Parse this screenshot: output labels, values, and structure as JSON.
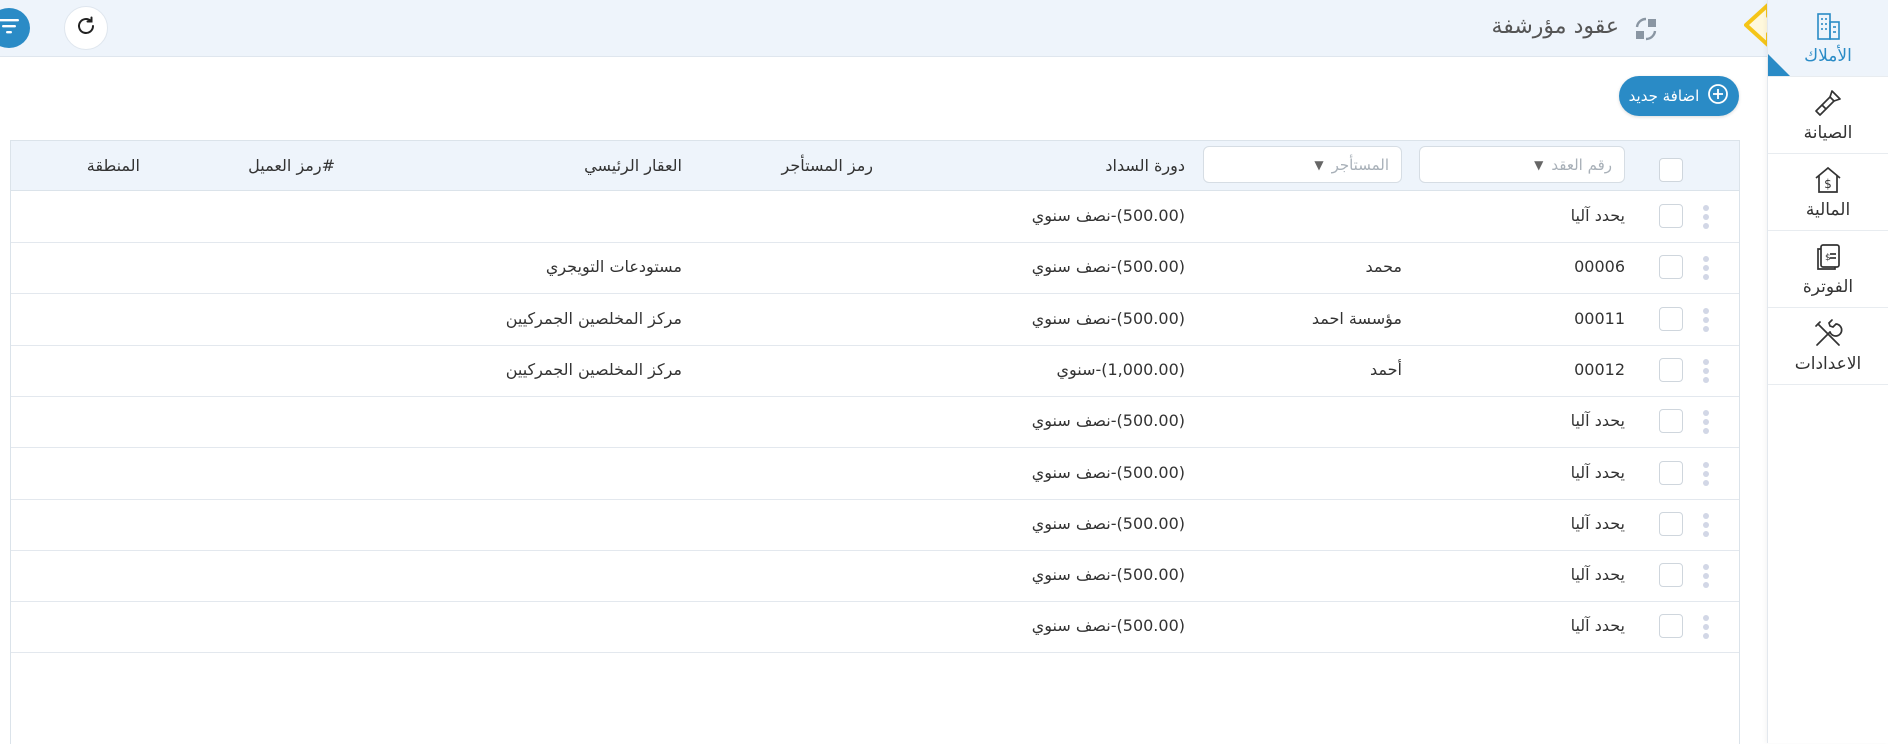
{
  "sidebar": {
    "items": [
      {
        "label": "الأملاك",
        "icon": "building-icon",
        "active": true
      },
      {
        "label": "الصيانة",
        "icon": "brush-icon",
        "active": false
      },
      {
        "label": "المالية",
        "icon": "finance-house-icon",
        "active": false
      },
      {
        "label": "الفوترة",
        "icon": "invoice-icon",
        "active": false
      },
      {
        "label": "الاعدادات",
        "icon": "tools-icon",
        "active": false
      }
    ]
  },
  "header": {
    "title": "عقود مؤرشفة",
    "icons": [
      "archive-icon",
      "arrow-left-icon",
      "refresh-icon",
      "filter-icon"
    ]
  },
  "toolbar": {
    "add_label": "اضافة جديد"
  },
  "table": {
    "filters": {
      "contract_number_placeholder": "رقم العقد",
      "tenant_placeholder": "المستأجر"
    },
    "columns": {
      "payment_cycle": "دورة السداد",
      "tenant_code": "رمز المستأجر",
      "main_property": "العقار الرئيسي",
      "client_code": "#رمز العميل",
      "region": "المنطقة"
    },
    "rows": [
      {
        "contract": "يحدد آليا",
        "tenant": "",
        "payment": "(500.00)-نصف سنوي",
        "property": ""
      },
      {
        "contract": "00006",
        "tenant": "محمد",
        "payment": "(500.00)-نصف سنوي",
        "property": "مستودعات التويجري"
      },
      {
        "contract": "00011",
        "tenant": "مؤسسة احمد",
        "payment": "(500.00)-نصف سنوي",
        "property": "مركز المخلصين الجمركيين"
      },
      {
        "contract": "00012",
        "tenant": "أحمد",
        "payment": "(1,000.00)-سنوي",
        "property": "مركز المخلصين الجمركيين"
      },
      {
        "contract": "يحدد آليا",
        "tenant": "",
        "payment": "(500.00)-نصف سنوي",
        "property": ""
      },
      {
        "contract": "يحدد آليا",
        "tenant": "",
        "payment": "(500.00)-نصف سنوي",
        "property": ""
      },
      {
        "contract": "يحدد آليا",
        "tenant": "",
        "payment": "(500.00)-نصف سنوي",
        "property": ""
      },
      {
        "contract": "يحدد آليا",
        "tenant": "",
        "payment": "(500.00)-نصف سنوي",
        "property": ""
      },
      {
        "contract": "يحدد آليا",
        "tenant": "",
        "payment": "(500.00)-نصف سنوي",
        "property": ""
      }
    ]
  },
  "colors": {
    "accent": "#2a8bc6",
    "header_bg": "#eef4fb",
    "arrow": "#f5c518"
  }
}
